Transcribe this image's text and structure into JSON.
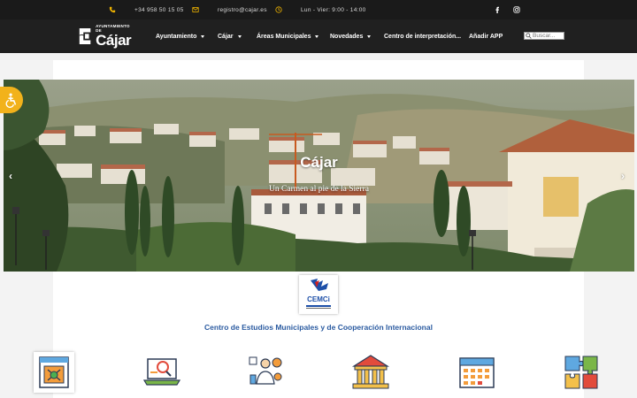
{
  "topbar": {
    "phone": "+34 958 50 15 05",
    "email": "registro@cajar.es",
    "hours": "Lun - Vier: 9:00 - 14:00",
    "icons": [
      "phone-icon",
      "email-icon",
      "clock-icon",
      "facebook-icon",
      "instagram-icon"
    ],
    "accent_color": "#f0b400"
  },
  "logo": {
    "supertitle": "AYUNTAMIENTO DE",
    "name": "Cájar"
  },
  "nav": {
    "items": [
      {
        "label": "Ayuntamiento",
        "has_dropdown": true
      },
      {
        "label": "Cájar",
        "has_dropdown": true
      },
      {
        "label": "Áreas Municipales",
        "has_dropdown": true
      },
      {
        "label": "Novedades",
        "has_dropdown": true
      },
      {
        "label": "Centro de interpretación...",
        "has_dropdown": false
      },
      {
        "label": "Añadir APP",
        "has_dropdown": false
      }
    ],
    "search_placeholder": "Buscar..."
  },
  "slider": {
    "title": "Cájar",
    "subtitle": "Un Carmen al pie de la Sierra",
    "prev_icon": "chevron-left-icon",
    "next_icon": "chevron-right-icon"
  },
  "accessibility": {
    "icon": "accessibility-icon",
    "color": "#f2b21b"
  },
  "cemci": {
    "logo_text": "CEMCi",
    "caption": "Centro de Estudios Municipales y de Cooperación Internacional",
    "caption_color": "#2a5aa0"
  },
  "services": [
    {
      "icon": "web-form-icon"
    },
    {
      "icon": "laptop-search-icon"
    },
    {
      "icon": "citizen-services-icon"
    },
    {
      "icon": "town-hall-icon"
    },
    {
      "icon": "calendar-icon"
    },
    {
      "icon": "puzzle-icon"
    }
  ]
}
